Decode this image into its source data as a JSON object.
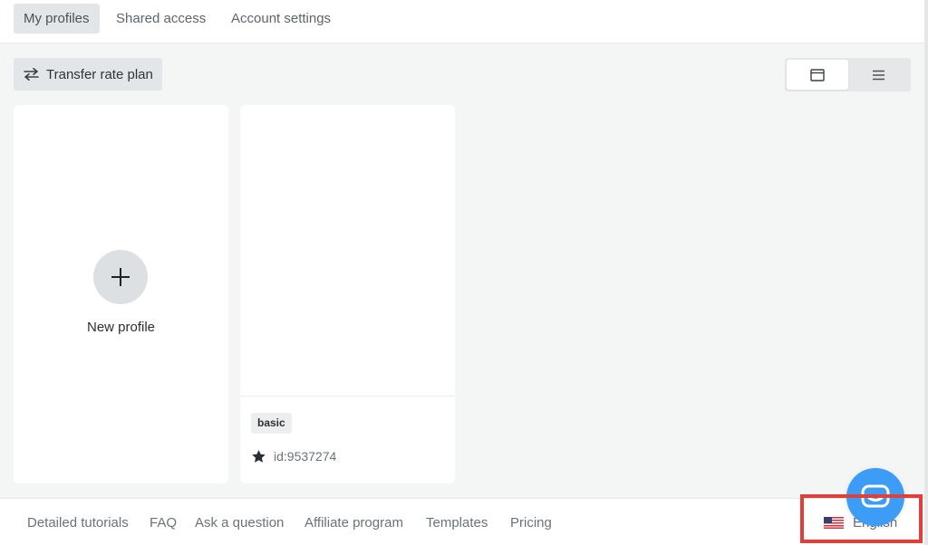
{
  "tabs": [
    {
      "label": "My profiles",
      "active": true
    },
    {
      "label": "Shared access",
      "active": false
    },
    {
      "label": "Account settings",
      "active": false
    }
  ],
  "toolbar": {
    "transfer_label": "Transfer rate plan",
    "transfer_icon": "swap-arrows-icon",
    "view_modes": [
      {
        "icon": "grid-view-icon",
        "active": true
      },
      {
        "icon": "list-view-icon",
        "active": false
      }
    ]
  },
  "new_profile": {
    "label": "New profile",
    "icon": "plus-icon"
  },
  "profiles": [
    {
      "tag": "basic",
      "favorite_icon": "star-icon",
      "id_text": "id:9537274"
    }
  ],
  "footer": {
    "links": [
      "Detailed tutorials",
      "FAQ",
      "Ask a question",
      "Affiliate program",
      "Templates",
      "Pricing"
    ],
    "language": {
      "label": "English",
      "icon": "us-flag-icon"
    }
  },
  "chat": {
    "icon": "chat-icon",
    "color": "#3d9cf5"
  },
  "colors": {
    "background": "#f4f5f5",
    "highlight": "#e0403a"
  }
}
